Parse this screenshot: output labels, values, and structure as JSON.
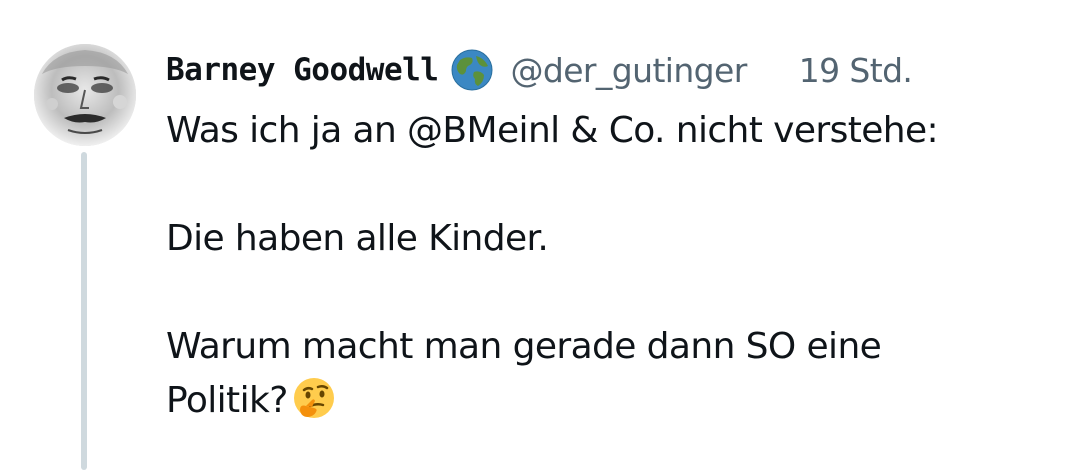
{
  "tweet": {
    "author_name": "Barney Goodwell",
    "author_badge_icon": "globe-emoji-icon",
    "handle": "@der_gutinger",
    "timestamp": "19 Std.",
    "lines": [
      "Was ich ja an @BMeinl & Co. nicht verstehe:",
      "Die haben alle Kinder.",
      "Warum macht man gerade dann SO eine",
      "Politik?"
    ],
    "trailing_emoji_icon": "thinking-face-emoji-icon"
  },
  "colors": {
    "text_primary": "#0f1419",
    "text_secondary": "#536471",
    "thread_line": "#cfd9de",
    "background": "#ffffff"
  }
}
